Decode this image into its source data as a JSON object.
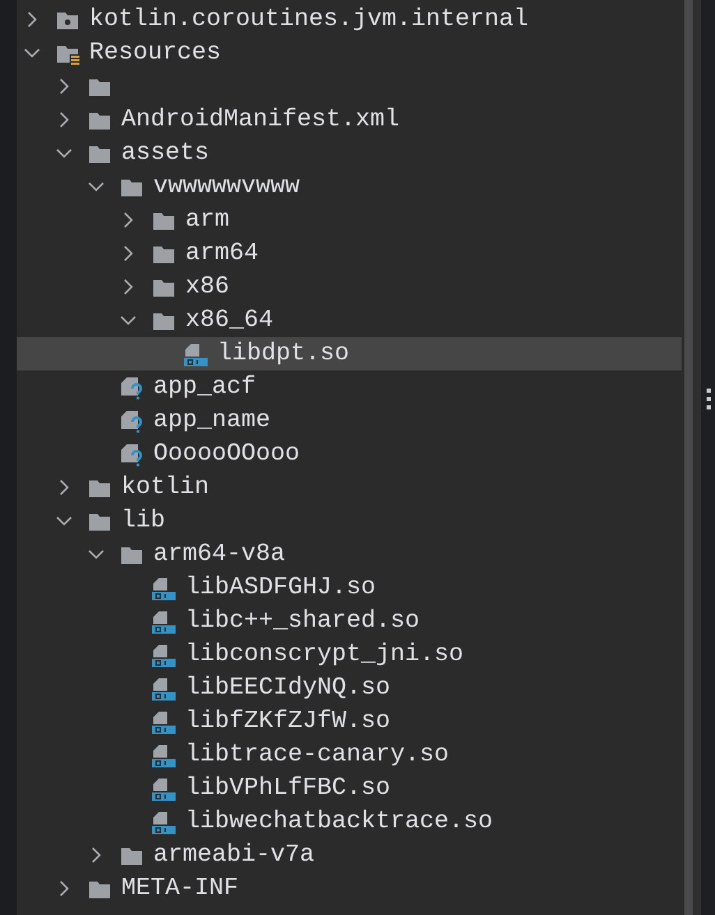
{
  "tree": [
    {
      "name": "kotlin.coroutines.jvm.internal",
      "kind": "package",
      "expanded": false,
      "selected": false
    },
    {
      "name": "Resources",
      "kind": "resources",
      "expanded": true,
      "selected": false,
      "children": [
        {
          "kind": "folder",
          "expanded": false,
          "selected": false
        },
        {
          "name": "AndroidManifest.xml",
          "kind": "folder",
          "expanded": false,
          "selected": false
        },
        {
          "name": "assets",
          "kind": "folder",
          "expanded": true,
          "selected": false,
          "children": [
            {
              "name": "vwwwwwvwww",
              "kind": "folder",
              "expanded": true,
              "selected": false,
              "children": [
                {
                  "name": "arm",
                  "kind": "folder",
                  "expanded": false,
                  "selected": false
                },
                {
                  "name": "arm64",
                  "kind": "folder",
                  "expanded": false,
                  "selected": false
                },
                {
                  "name": "x86",
                  "kind": "folder",
                  "expanded": false,
                  "selected": false
                },
                {
                  "name": "x86_64",
                  "kind": "folder",
                  "expanded": true,
                  "selected": false,
                  "children": [
                    {
                      "name": "libdpt.so",
                      "kind": "binary",
                      "selected": true
                    }
                  ]
                }
              ]
            },
            {
              "name": "app_acf",
              "kind": "unknown",
              "selected": false
            },
            {
              "name": "app_name",
              "kind": "unknown",
              "selected": false
            },
            {
              "name": "OooooOOooo",
              "kind": "unknown",
              "selected": false
            }
          ]
        },
        {
          "name": "kotlin",
          "kind": "folder",
          "expanded": false,
          "selected": false
        },
        {
          "name": "lib",
          "kind": "folder",
          "expanded": true,
          "selected": false,
          "children": [
            {
              "name": "arm64-v8a",
              "kind": "folder",
              "expanded": true,
              "selected": false,
              "children": [
                {
                  "name": "libASDFGHJ.so",
                  "kind": "binary",
                  "selected": false
                },
                {
                  "name": "libc++_shared.so",
                  "kind": "binary",
                  "selected": false
                },
                {
                  "name": "libconscrypt_jni.so",
                  "kind": "binary",
                  "selected": false
                },
                {
                  "name": "libEECIdyNQ.so",
                  "kind": "binary",
                  "selected": false
                },
                {
                  "name": "libfZKfZJfW.so",
                  "kind": "binary",
                  "selected": false
                },
                {
                  "name": "libtrace-canary.so",
                  "kind": "binary",
                  "selected": false
                },
                {
                  "name": "libVPhLfFBC.so",
                  "kind": "binary",
                  "selected": false
                },
                {
                  "name": "libwechatbacktrace.so",
                  "kind": "binary",
                  "selected": false
                }
              ]
            },
            {
              "name": "armeabi-v7a",
              "kind": "folder",
              "expanded": false,
              "selected": false
            }
          ]
        },
        {
          "name": "META-INF",
          "kind": "folder",
          "expanded": false,
          "selected": false
        }
      ]
    }
  ]
}
